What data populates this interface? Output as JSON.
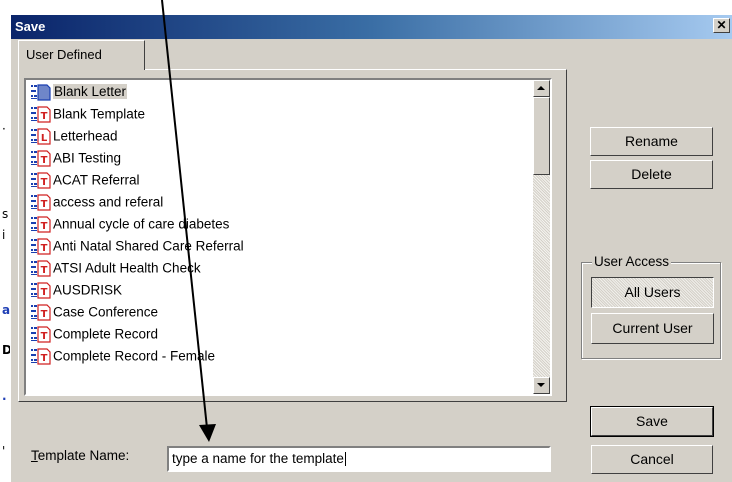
{
  "background": {
    "fragments": [
      "·",
      "s",
      "i",
      "a",
      "D",
      "·",
      "'"
    ]
  },
  "dialog": {
    "title": "Save",
    "close_glyph": "✕"
  },
  "tab": {
    "label": "User Defined"
  },
  "templates": {
    "items": [
      {
        "label": "Blank Letter",
        "icon": "letter-doc-icon",
        "selected": true
      },
      {
        "label": "Blank Template",
        "icon": "template-doc-icon",
        "selected": false
      },
      {
        "label": "Letterhead",
        "icon": "letterhead-doc-icon",
        "selected": false
      },
      {
        "label": "ABI Testing",
        "icon": "template-doc-icon",
        "selected": false
      },
      {
        "label": "ACAT Referral",
        "icon": "template-doc-icon",
        "selected": false
      },
      {
        "label": "access and referal",
        "icon": "template-doc-icon",
        "selected": false
      },
      {
        "label": "Annual cycle of care diabetes",
        "icon": "template-doc-icon",
        "selected": false
      },
      {
        "label": "Anti Natal Shared Care Referral",
        "icon": "template-doc-icon",
        "selected": false
      },
      {
        "label": "ATSI Adult Health Check",
        "icon": "template-doc-icon",
        "selected": false
      },
      {
        "label": "AUSDRISK",
        "icon": "template-doc-icon",
        "selected": false
      },
      {
        "label": "Case Conference",
        "icon": "template-doc-icon",
        "selected": false
      },
      {
        "label": "Complete Record",
        "icon": "template-doc-icon",
        "selected": false
      },
      {
        "label": "Complete Record - Female",
        "icon": "template-doc-icon",
        "selected": false
      }
    ]
  },
  "buttons": {
    "rename": "Rename",
    "delete": "Delete",
    "save": "Save",
    "cancel": "Cancel"
  },
  "user_access": {
    "label": "User Access",
    "all_users": "All Users",
    "current_user": "Current User",
    "selected": "All Users"
  },
  "template_name": {
    "label_mnemonic": "T",
    "label_rest": "emplate Name:",
    "value": "type a name for the template"
  },
  "colors": {
    "face": "#d4d0c8",
    "title_start": "#0a246a",
    "title_end": "#a6caf0",
    "icon_red": "#d02020",
    "icon_blue": "#1a3fb0"
  }
}
